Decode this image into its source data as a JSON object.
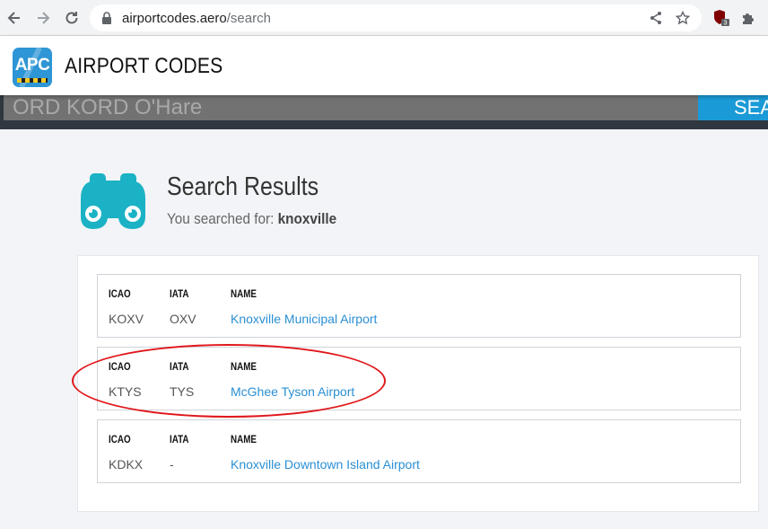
{
  "browser": {
    "url_domain": "airportcodes.aero",
    "url_path": "/search",
    "extension_badge": "3",
    "icons": [
      "back-arrow-icon",
      "forward-arrow-icon",
      "reload-icon",
      "lock-icon",
      "share-icon",
      "star-icon",
      "ublock-extension-icon",
      "puzzle-extension-icon"
    ]
  },
  "site": {
    "logo_text": "APC",
    "title": "AIRPORT CODES"
  },
  "search": {
    "placeholder": "ORD KORD O'Hare",
    "button_label": "SEARCH"
  },
  "results": {
    "title": "Search Results",
    "subtitle_prefix": "You searched for:",
    "query": "knoxville",
    "column_headers": {
      "icao": "ICAO",
      "iata": "IATA",
      "name": "NAME"
    },
    "items": [
      {
        "icao": "KOXV",
        "iata": "OXV",
        "name": "Knoxville Municipal Airport"
      },
      {
        "icao": "KTYS",
        "iata": "TYS",
        "name": "McGhee Tyson Airport"
      },
      {
        "icao": "KDKX",
        "iata": "-",
        "name": "Knoxville Downtown Island Airport"
      }
    ]
  },
  "colors": {
    "accent": "#2e96d4",
    "link": "#2a8fd4",
    "binoculars": "#1ab2c4",
    "highlight_circle": "#e0171b",
    "search_button": "#1a9ad6"
  }
}
